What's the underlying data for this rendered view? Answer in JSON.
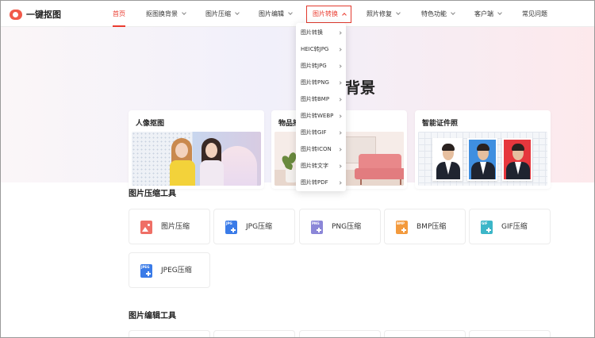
{
  "brand": {
    "logo_text": "一键抠图"
  },
  "nav": {
    "items": [
      {
        "label": "首页",
        "has_chevron": false,
        "state": "active"
      },
      {
        "label": "抠图换背景",
        "has_chevron": true,
        "state": "normal"
      },
      {
        "label": "图片压缩",
        "has_chevron": true,
        "state": "normal"
      },
      {
        "label": "图片编辑",
        "has_chevron": true,
        "state": "normal"
      },
      {
        "label": "图片转换",
        "has_chevron": true,
        "state": "open"
      },
      {
        "label": "照片修复",
        "has_chevron": true,
        "state": "normal"
      },
      {
        "label": "特色功能",
        "has_chevron": true,
        "state": "normal"
      },
      {
        "label": "客户端",
        "has_chevron": true,
        "state": "normal"
      },
      {
        "label": "常见问题",
        "has_chevron": false,
        "state": "normal"
      }
    ]
  },
  "dropdown": {
    "items": [
      "图片转换",
      "HEIC转JPG",
      "图片转JPG",
      "图片转PNG",
      "图片转BMP",
      "图片转WEBP",
      "图片转GIF",
      "图片转ICON",
      "图片转文字",
      "图片转PDF"
    ]
  },
  "hero": {
    "title_fragment": "背景",
    "cards": [
      {
        "title": "人像抠图"
      },
      {
        "title": "物品抠"
      },
      {
        "title": "智能证件照"
      }
    ]
  },
  "compress_section": {
    "title": "图片压缩工具",
    "tools": [
      {
        "label": "图片压缩",
        "icon": "image-icon",
        "color": "#ef6f66",
        "tag": ""
      },
      {
        "label": "JPG压缩",
        "icon": "jpg-file-icon",
        "color": "#3a7be8",
        "tag": "JPG"
      },
      {
        "label": "PNG压缩",
        "icon": "png-file-icon",
        "color": "#8b86d8",
        "tag": "PNG"
      },
      {
        "label": "BMP压缩",
        "icon": "bmp-file-icon",
        "color": "#f39a3d",
        "tag": "BMP"
      },
      {
        "label": "GIF压缩",
        "icon": "gif-file-icon",
        "color": "#3cb6c8",
        "tag": "GIF"
      },
      {
        "label": "JPEG压缩",
        "icon": "jpeg-file-icon",
        "color": "#3a7be8",
        "tag": "JPEG"
      }
    ]
  },
  "edit_section": {
    "title": "图片编辑工具"
  },
  "colors": {
    "accent": "#ea3b2f"
  }
}
